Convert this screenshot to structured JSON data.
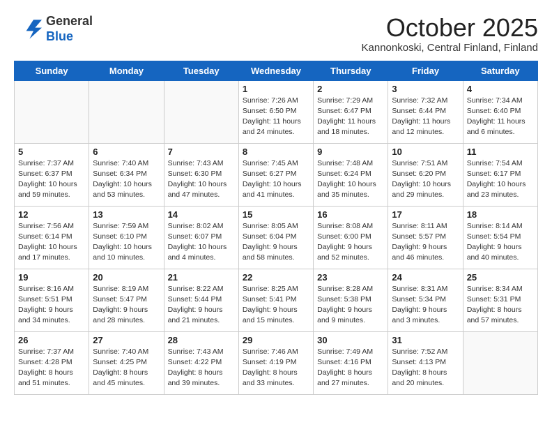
{
  "header": {
    "logo": {
      "line1": "General",
      "line2": "Blue"
    },
    "title": "October 2025",
    "location": "Kannonkoski, Central Finland, Finland"
  },
  "days_of_week": [
    "Sunday",
    "Monday",
    "Tuesday",
    "Wednesday",
    "Thursday",
    "Friday",
    "Saturday"
  ],
  "weeks": [
    [
      {
        "day": "",
        "info": ""
      },
      {
        "day": "",
        "info": ""
      },
      {
        "day": "",
        "info": ""
      },
      {
        "day": "1",
        "info": "Sunrise: 7:26 AM\nSunset: 6:50 PM\nDaylight: 11 hours\nand 24 minutes."
      },
      {
        "day": "2",
        "info": "Sunrise: 7:29 AM\nSunset: 6:47 PM\nDaylight: 11 hours\nand 18 minutes."
      },
      {
        "day": "3",
        "info": "Sunrise: 7:32 AM\nSunset: 6:44 PM\nDaylight: 11 hours\nand 12 minutes."
      },
      {
        "day": "4",
        "info": "Sunrise: 7:34 AM\nSunset: 6:40 PM\nDaylight: 11 hours\nand 6 minutes."
      }
    ],
    [
      {
        "day": "5",
        "info": "Sunrise: 7:37 AM\nSunset: 6:37 PM\nDaylight: 10 hours\nand 59 minutes."
      },
      {
        "day": "6",
        "info": "Sunrise: 7:40 AM\nSunset: 6:34 PM\nDaylight: 10 hours\nand 53 minutes."
      },
      {
        "day": "7",
        "info": "Sunrise: 7:43 AM\nSunset: 6:30 PM\nDaylight: 10 hours\nand 47 minutes."
      },
      {
        "day": "8",
        "info": "Sunrise: 7:45 AM\nSunset: 6:27 PM\nDaylight: 10 hours\nand 41 minutes."
      },
      {
        "day": "9",
        "info": "Sunrise: 7:48 AM\nSunset: 6:24 PM\nDaylight: 10 hours\nand 35 minutes."
      },
      {
        "day": "10",
        "info": "Sunrise: 7:51 AM\nSunset: 6:20 PM\nDaylight: 10 hours\nand 29 minutes."
      },
      {
        "day": "11",
        "info": "Sunrise: 7:54 AM\nSunset: 6:17 PM\nDaylight: 10 hours\nand 23 minutes."
      }
    ],
    [
      {
        "day": "12",
        "info": "Sunrise: 7:56 AM\nSunset: 6:14 PM\nDaylight: 10 hours\nand 17 minutes."
      },
      {
        "day": "13",
        "info": "Sunrise: 7:59 AM\nSunset: 6:10 PM\nDaylight: 10 hours\nand 10 minutes."
      },
      {
        "day": "14",
        "info": "Sunrise: 8:02 AM\nSunset: 6:07 PM\nDaylight: 10 hours\nand 4 minutes."
      },
      {
        "day": "15",
        "info": "Sunrise: 8:05 AM\nSunset: 6:04 PM\nDaylight: 9 hours\nand 58 minutes."
      },
      {
        "day": "16",
        "info": "Sunrise: 8:08 AM\nSunset: 6:00 PM\nDaylight: 9 hours\nand 52 minutes."
      },
      {
        "day": "17",
        "info": "Sunrise: 8:11 AM\nSunset: 5:57 PM\nDaylight: 9 hours\nand 46 minutes."
      },
      {
        "day": "18",
        "info": "Sunrise: 8:14 AM\nSunset: 5:54 PM\nDaylight: 9 hours\nand 40 minutes."
      }
    ],
    [
      {
        "day": "19",
        "info": "Sunrise: 8:16 AM\nSunset: 5:51 PM\nDaylight: 9 hours\nand 34 minutes."
      },
      {
        "day": "20",
        "info": "Sunrise: 8:19 AM\nSunset: 5:47 PM\nDaylight: 9 hours\nand 28 minutes."
      },
      {
        "day": "21",
        "info": "Sunrise: 8:22 AM\nSunset: 5:44 PM\nDaylight: 9 hours\nand 21 minutes."
      },
      {
        "day": "22",
        "info": "Sunrise: 8:25 AM\nSunset: 5:41 PM\nDaylight: 9 hours\nand 15 minutes."
      },
      {
        "day": "23",
        "info": "Sunrise: 8:28 AM\nSunset: 5:38 PM\nDaylight: 9 hours\nand 9 minutes."
      },
      {
        "day": "24",
        "info": "Sunrise: 8:31 AM\nSunset: 5:34 PM\nDaylight: 9 hours\nand 3 minutes."
      },
      {
        "day": "25",
        "info": "Sunrise: 8:34 AM\nSunset: 5:31 PM\nDaylight: 8 hours\nand 57 minutes."
      }
    ],
    [
      {
        "day": "26",
        "info": "Sunrise: 7:37 AM\nSunset: 4:28 PM\nDaylight: 8 hours\nand 51 minutes."
      },
      {
        "day": "27",
        "info": "Sunrise: 7:40 AM\nSunset: 4:25 PM\nDaylight: 8 hours\nand 45 minutes."
      },
      {
        "day": "28",
        "info": "Sunrise: 7:43 AM\nSunset: 4:22 PM\nDaylight: 8 hours\nand 39 minutes."
      },
      {
        "day": "29",
        "info": "Sunrise: 7:46 AM\nSunset: 4:19 PM\nDaylight: 8 hours\nand 33 minutes."
      },
      {
        "day": "30",
        "info": "Sunrise: 7:49 AM\nSunset: 4:16 PM\nDaylight: 8 hours\nand 27 minutes."
      },
      {
        "day": "31",
        "info": "Sunrise: 7:52 AM\nSunset: 4:13 PM\nDaylight: 8 hours\nand 20 minutes."
      },
      {
        "day": "",
        "info": ""
      }
    ]
  ]
}
